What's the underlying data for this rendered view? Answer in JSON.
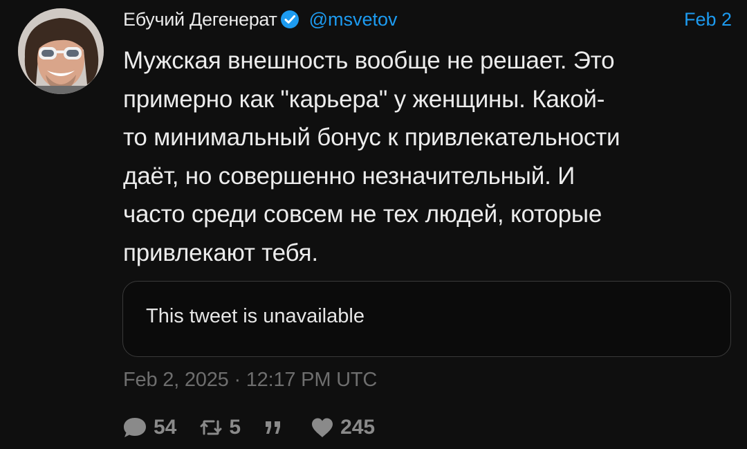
{
  "author": {
    "display_name": "Ебучий Дегенерат",
    "handle": "@msvetov",
    "verified": true,
    "avatar": "profile-photo"
  },
  "date_short": "Feb 2",
  "text": "Мужская внешность вообще не решает. Это\nпримерно как \"карьера\" у женщины. Какой-\nто минимальный бонус к привлекательности\nдаёт, но совершенно незначительный. И\nчасто среди совсем не тех людей, которые\nпривлекают тебя.",
  "quoted_tweet": {
    "message": "This tweet is unavailable"
  },
  "timestamp": "Feb 2, 2025 · 12:17 PM UTC",
  "stats": {
    "replies": "54",
    "retweets": "5",
    "quotes": "",
    "likes": "245"
  },
  "icons": {
    "reply": "comment-icon",
    "retweet": "retweet-icon",
    "quote": "quote-icon",
    "like": "heart-icon",
    "verified": "verified-badge-icon"
  },
  "colors": {
    "background": "#0f0f0f",
    "accent": "#1d9bf0",
    "text": "#ececec",
    "muted": "#6e6e6e",
    "icon": "#8a8a8a"
  }
}
